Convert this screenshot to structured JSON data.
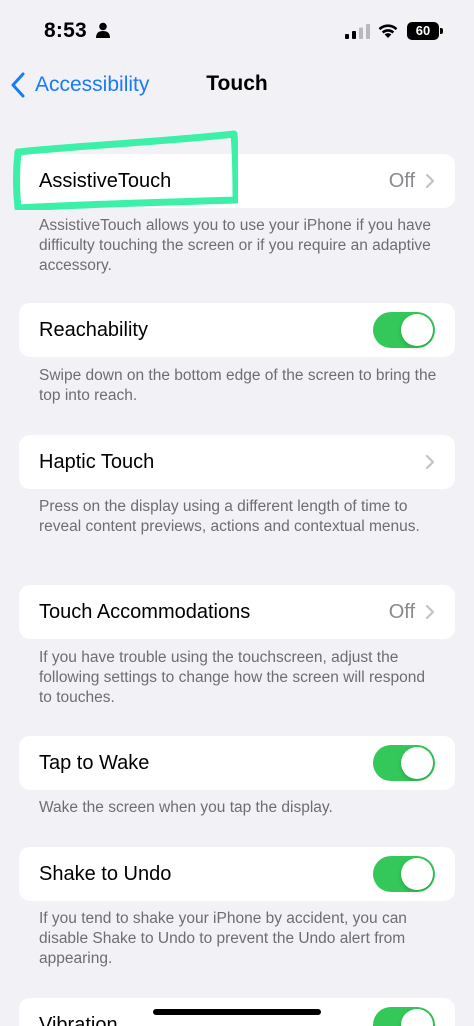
{
  "status_bar": {
    "time": "8:53",
    "battery": "60"
  },
  "nav": {
    "back_label": "Accessibility",
    "title": "Touch"
  },
  "colors": {
    "accent": "#1a7cf5",
    "toggle_on": "#34c759",
    "highlight": "#3df0a8"
  },
  "settings": [
    {
      "label": "AssistiveTouch",
      "value": "Off",
      "footer": "AssistiveTouch allows you to use your iPhone if you have difficulty touching the screen or if you require an adaptive accessory."
    },
    {
      "label": "Reachability",
      "toggle": "on",
      "footer": "Swipe down on the bottom edge of the screen to bring the top into reach."
    },
    {
      "label": "Haptic Touch",
      "footer": "Press on the display using a different length of time to reveal content previews, actions and contextual menus."
    },
    {
      "label": "Touch Accommodations",
      "value": "Off",
      "footer": "If you have trouble using the touchscreen, adjust the following settings to change how the screen will respond to touches."
    },
    {
      "label": "Tap to Wake",
      "toggle": "on",
      "footer": "Wake the screen when you tap the display."
    },
    {
      "label": "Shake to Undo",
      "toggle": "on",
      "footer": "If you tend to shake your iPhone by accident, you can disable Shake to Undo to prevent the Undo alert from appearing."
    },
    {
      "label": "Vibration",
      "toggle": "on"
    }
  ]
}
